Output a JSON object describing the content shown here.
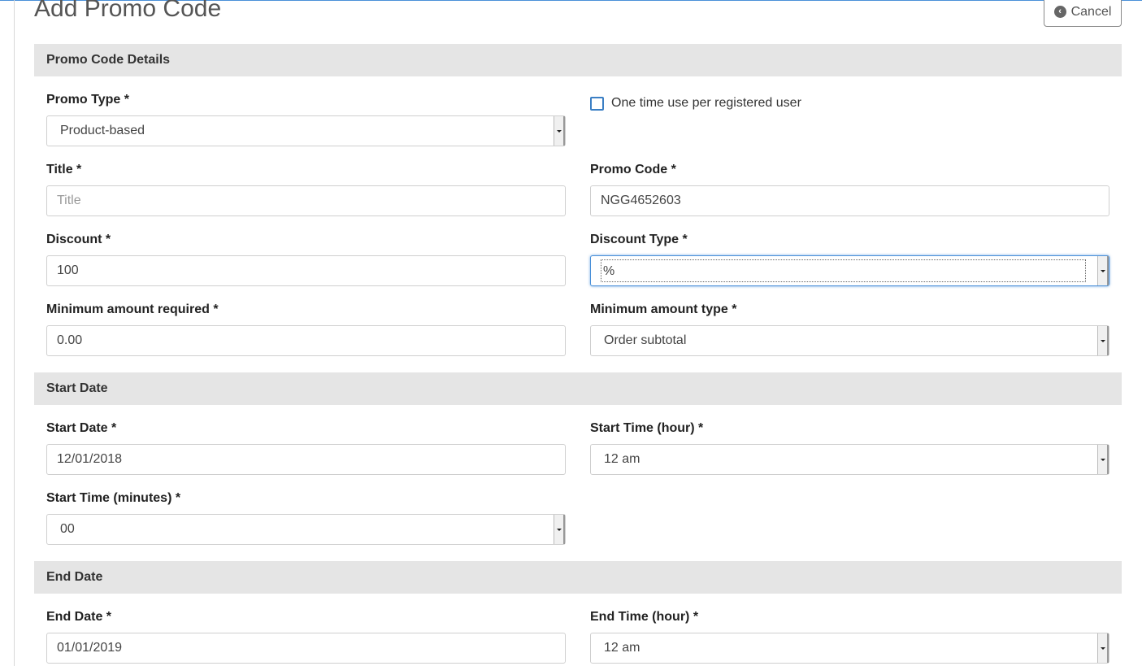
{
  "page": {
    "title": "Add Promo Code",
    "cancel_label": "Cancel",
    "cancel_icon": "arrow-circle-left-icon"
  },
  "sections": {
    "details": "Promo Code Details",
    "start": "Start Date",
    "end": "End Date"
  },
  "fields": {
    "promo_type": {
      "label": "Promo Type *",
      "value": "Product-based"
    },
    "one_time": {
      "label": "One time use per registered user",
      "checked": false
    },
    "title": {
      "label": "Title *",
      "placeholder": "Title"
    },
    "promo_code": {
      "label": "Promo Code *",
      "value": "NGG4652603"
    },
    "discount": {
      "label": "Discount *",
      "value": "100"
    },
    "discount_type": {
      "label": "Discount Type *",
      "value": "%"
    },
    "min_amount": {
      "label": "Minimum amount required *",
      "value": "0.00"
    },
    "min_amount_type": {
      "label": "Minimum amount type *",
      "value": "Order subtotal"
    },
    "start_date": {
      "label": "Start Date *",
      "value": "12/01/2018"
    },
    "start_hour": {
      "label": "Start Time (hour) *",
      "value": "12 am"
    },
    "start_minutes": {
      "label": "Start Time (minutes) *",
      "value": "00"
    },
    "end_date": {
      "label": "End Date *",
      "value": "01/01/2019"
    },
    "end_hour": {
      "label": "End Time (hour) *",
      "value": "12 am"
    }
  },
  "colors": {
    "accent": "#4a90d9",
    "section_bg": "#e5e5e5",
    "checkbox_border": "#3b7fc4"
  }
}
